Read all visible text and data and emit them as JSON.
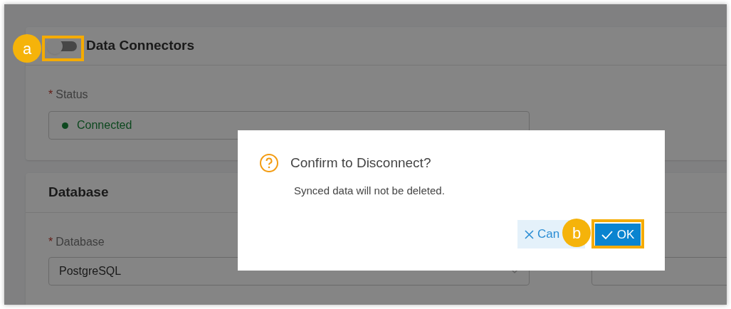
{
  "connectors": {
    "title": "Data Connectors",
    "toggle": {
      "on": false
    },
    "status": {
      "mark": "*",
      "label": "Status",
      "value": "Connected"
    }
  },
  "database": {
    "title": "Database",
    "fields": [
      {
        "mark": "*",
        "label": "Database",
        "value": "PostgreSQL",
        "kind": "select"
      },
      {
        "kind": "text"
      }
    ]
  },
  "dialog": {
    "title": "Confirm to Disconnect?",
    "message": "Synced data will not be deleted.",
    "cancel": "Can",
    "ok": "OK"
  },
  "annotations": [
    "a",
    "b"
  ]
}
